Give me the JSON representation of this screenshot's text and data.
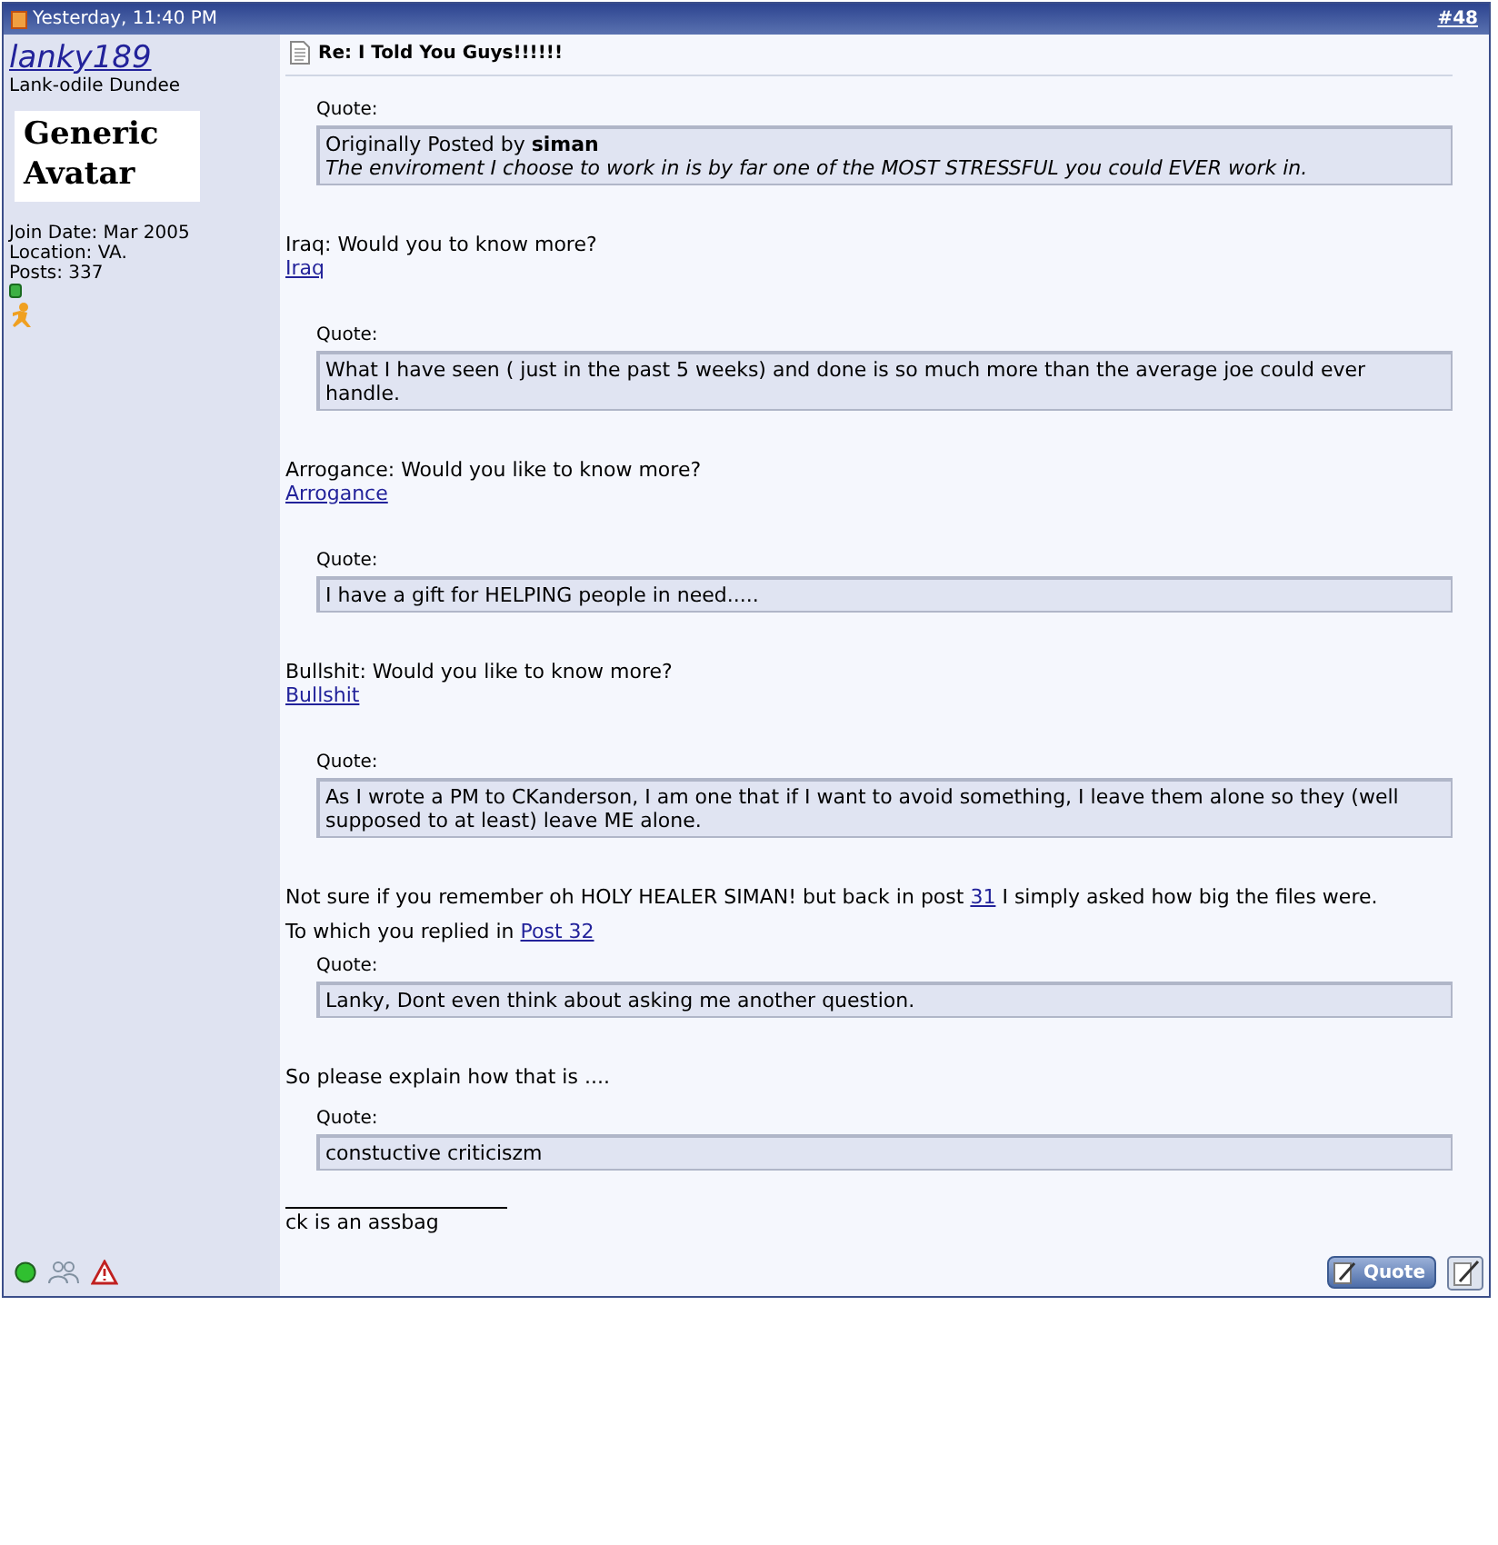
{
  "header": {
    "date": "Yesterday, 11:40 PM",
    "post_number": "#48"
  },
  "user": {
    "name": "lanky189",
    "title": "Lank-odile Dundee",
    "avatar_text": "Generic Avatar",
    "join_date": "Join Date: Mar 2005",
    "location": "Location: VA.",
    "posts": "Posts: 337"
  },
  "post": {
    "title": "Re: I Told You Guys!!!!!!",
    "blocks": [
      {
        "kind": "quote",
        "label": "Quote:",
        "attribution": "Originally Posted by",
        "author": "siman",
        "text": "The enviroment I choose to work in is by far one of the MOST STRESSFUL you could EVER work in."
      },
      {
        "kind": "text",
        "text": "Iraq: Would you to know more?"
      },
      {
        "kind": "link",
        "text": "Iraq"
      },
      {
        "kind": "quote",
        "label": "Quote:",
        "text": "What I have seen ( just in the past 5 weeks) and done is so much more than the average joe could ever handle."
      },
      {
        "kind": "text",
        "text": "Arrogance: Would you like to know more?"
      },
      {
        "kind": "link",
        "text": "Arrogance"
      },
      {
        "kind": "quote",
        "label": "Quote:",
        "text": "I have a gift for HELPING people in need....."
      },
      {
        "kind": "text",
        "text": "Bullshit: Would you like to know more?"
      },
      {
        "kind": "link",
        "text": "Bullshit"
      },
      {
        "kind": "quote",
        "label": "Quote:",
        "text": "As I wrote a PM to CKanderson, I am one that if I want to avoid something, I leave them alone so they (well supposed to at least) leave ME alone."
      },
      {
        "kind": "para",
        "before": "Not sure if you remember oh HOLY HEALER SIMAN! but back in post",
        "link": "31",
        "after": "I simply asked how big the files were."
      },
      {
        "kind": "para",
        "before": "To which you replied in",
        "link": "Post 32"
      },
      {
        "kind": "quote",
        "label": "Quote:",
        "text": "Lanky, Dont even think about asking me another question."
      },
      {
        "kind": "text",
        "text": "So please explain how that is ...."
      },
      {
        "kind": "quote",
        "label": "Quote:",
        "text": "constuctive criticiszm"
      }
    ],
    "signature": "ck is an assbag"
  },
  "footer": {
    "quote_button": "Quote"
  }
}
